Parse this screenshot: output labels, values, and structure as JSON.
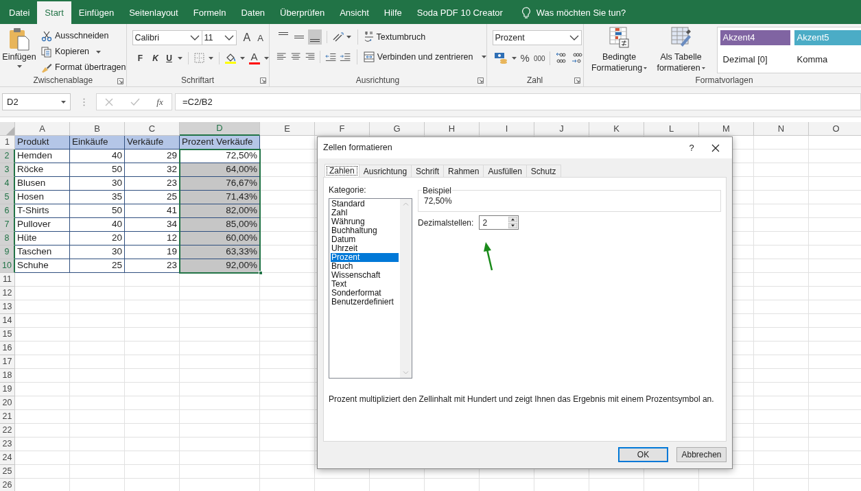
{
  "ribbon_tabs": [
    {
      "label": "Datei",
      "selected": false
    },
    {
      "label": "Start",
      "selected": true
    },
    {
      "label": "Einfügen",
      "selected": false
    },
    {
      "label": "Seitenlayout",
      "selected": false
    },
    {
      "label": "Formeln",
      "selected": false
    },
    {
      "label": "Daten",
      "selected": false
    },
    {
      "label": "Überprüfen",
      "selected": false
    },
    {
      "label": "Ansicht",
      "selected": false
    },
    {
      "label": "Hilfe",
      "selected": false
    },
    {
      "label": "Soda PDF 10 Creator",
      "selected": false
    }
  ],
  "tell_me": "Was möchten Sie tun?",
  "clipboard": {
    "paste": "Einfügen",
    "cut": "Ausschneiden",
    "copy": "Kopieren",
    "format_painter": "Format übertragen",
    "group_label": "Zwischenablage"
  },
  "font": {
    "font_name": "Calibri",
    "font_size": "11",
    "grow": "A",
    "shrink": "A",
    "bold": "F",
    "italic": "K",
    "underline": "U",
    "font_color": "A",
    "group_label": "Schriftart"
  },
  "alignment": {
    "vertical_align": [
      {
        "selected": false
      },
      {
        "selected": false
      },
      {
        "selected": true
      }
    ],
    "wrap_text": "Textumbruch",
    "merge": "Verbinden und zentrieren",
    "group_label": "Ausrichtung"
  },
  "number": {
    "format": "Prozent",
    "percent": "%",
    "thousands": "000",
    "group_label": "Zahl"
  },
  "styles": {
    "conditional": [
      "Bedingte",
      "Formatierung"
    ],
    "as_table": [
      "Als Tabelle",
      "formatieren"
    ],
    "gallery": [
      {
        "label": "Akzent4",
        "color": "#8064a2"
      },
      {
        "label": "Akzent5",
        "color": "#4bacc6"
      },
      {
        "label": "Dezimal [0]"
      },
      {
        "label": "Komma"
      }
    ],
    "group_label": "Formatvorlagen"
  },
  "formula_bar": {
    "name_box": "D2",
    "fx": "fx",
    "formula": "=C2/B2"
  },
  "sheet": {
    "columns": [
      {
        "label": "A",
        "selected": false
      },
      {
        "label": "B",
        "selected": false
      },
      {
        "label": "C",
        "selected": false
      },
      {
        "label": "D",
        "selected": true
      },
      {
        "label": "E",
        "selected": false
      },
      {
        "label": "F",
        "selected": false
      },
      {
        "label": "G",
        "selected": false
      },
      {
        "label": "H",
        "selected": false
      },
      {
        "label": "I",
        "selected": false
      },
      {
        "label": "J",
        "selected": false
      },
      {
        "label": "K",
        "selected": false
      },
      {
        "label": "L",
        "selected": false
      },
      {
        "label": "M",
        "selected": false
      },
      {
        "label": "N",
        "selected": false
      },
      {
        "label": "O",
        "selected": false
      }
    ],
    "rows": [
      {
        "number": "1",
        "selected": false,
        "kind": "header",
        "cells": [
          "Produkt",
          "Einkäufe",
          "Verkäufe",
          "Prozent Verkäufe"
        ]
      },
      {
        "number": "2",
        "selected": true,
        "kind": "data",
        "cells": [
          "Hemden",
          "40",
          "29",
          "72,50%"
        ]
      },
      {
        "number": "3",
        "selected": true,
        "kind": "data",
        "cells": [
          "Röcke",
          "50",
          "32",
          "64,00%"
        ]
      },
      {
        "number": "4",
        "selected": true,
        "kind": "data",
        "cells": [
          "Blusen",
          "30",
          "23",
          "76,67%"
        ]
      },
      {
        "number": "5",
        "selected": true,
        "kind": "data",
        "cells": [
          "Hosen",
          "35",
          "25",
          "71,43%"
        ]
      },
      {
        "number": "6",
        "selected": true,
        "kind": "data",
        "cells": [
          "T-Shirts",
          "50",
          "41",
          "82,00%"
        ]
      },
      {
        "number": "7",
        "selected": true,
        "kind": "data",
        "cells": [
          "Pullover",
          "40",
          "34",
          "85,00%"
        ]
      },
      {
        "number": "8",
        "selected": true,
        "kind": "data",
        "cells": [
          "Hüte",
          "20",
          "12",
          "60,00%"
        ]
      },
      {
        "number": "9",
        "selected": true,
        "kind": "data",
        "cells": [
          "Taschen",
          "30",
          "19",
          "63,33%"
        ]
      },
      {
        "number": "10",
        "selected": true,
        "kind": "data",
        "cells": [
          "Schuhe",
          "25",
          "23",
          "92,00%"
        ]
      },
      {
        "number": "11",
        "selected": false
      },
      {
        "number": "12",
        "selected": false
      },
      {
        "number": "13",
        "selected": false
      },
      {
        "number": "14",
        "selected": false
      },
      {
        "number": "15",
        "selected": false
      },
      {
        "number": "16",
        "selected": false
      },
      {
        "number": "17",
        "selected": false
      },
      {
        "number": "18",
        "selected": false
      },
      {
        "number": "19",
        "selected": false
      },
      {
        "number": "20",
        "selected": false
      },
      {
        "number": "21",
        "selected": false
      },
      {
        "number": "22",
        "selected": false
      },
      {
        "number": "23",
        "selected": false
      },
      {
        "number": "24",
        "selected": false
      },
      {
        "number": "25",
        "selected": false
      },
      {
        "number": "26",
        "selected": false
      }
    ]
  },
  "dialog": {
    "title": "Zellen formatieren",
    "help": "?",
    "tabs": [
      {
        "label": "Zahlen",
        "selected": true
      },
      {
        "label": "Ausrichtung",
        "selected": false
      },
      {
        "label": "Schrift",
        "selected": false
      },
      {
        "label": "Rahmen",
        "selected": false
      },
      {
        "label": "Ausfüllen",
        "selected": false
      },
      {
        "label": "Schutz",
        "selected": false
      }
    ],
    "category_label": "Kategorie:",
    "categories": [
      {
        "label": "Standard",
        "selected": false
      },
      {
        "label": "Zahl",
        "selected": false
      },
      {
        "label": "Währung",
        "selected": false
      },
      {
        "label": "Buchhaltung",
        "selected": false
      },
      {
        "label": "Datum",
        "selected": false
      },
      {
        "label": "Uhrzeit",
        "selected": false
      },
      {
        "label": "Prozent",
        "selected": true
      },
      {
        "label": "Bruch",
        "selected": false
      },
      {
        "label": "Wissenschaft",
        "selected": false
      },
      {
        "label": "Text",
        "selected": false
      },
      {
        "label": "Sonderformat",
        "selected": false
      },
      {
        "label": "Benutzerdefiniert",
        "selected": false
      }
    ],
    "sample_label": "Beispiel",
    "sample_value": "72,50%",
    "decimals_label": "Dezimalstellen:",
    "decimals_value": "2",
    "description": "Prozent multipliziert den Zellinhalt mit Hundert und zeigt Ihnen das Ergebnis mit einem Prozentsymbol an.",
    "buttons": [
      {
        "label": "OK",
        "kind": "default"
      },
      {
        "label": "Abbrechen",
        "kind": "normal"
      }
    ]
  }
}
